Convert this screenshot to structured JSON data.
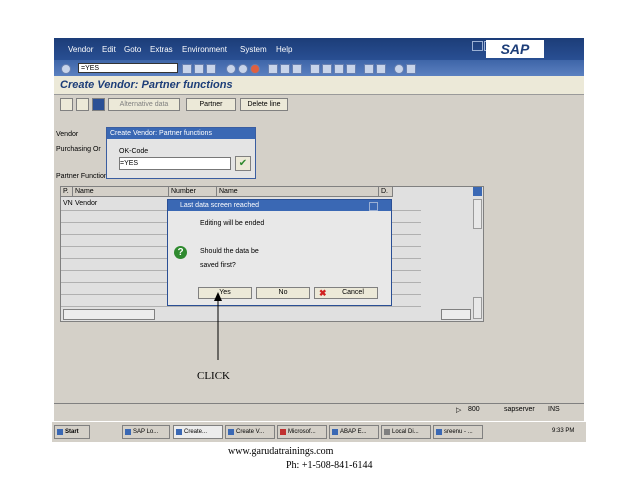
{
  "menubar": {
    "items": [
      "Vendor",
      "Edit",
      "Goto",
      "Extras",
      "Environment",
      "System",
      "Help"
    ],
    "logo": "SAP"
  },
  "toolbar": {
    "okcode_value": "=YES"
  },
  "screen": {
    "title": "Create Vendor: Partner functions"
  },
  "app_toolbar": {
    "alt_data_label": "Alternative data",
    "partner_label": "Partner",
    "delete_line_label": "Delete line"
  },
  "fields": {
    "vendor_label": "Vendor",
    "purchasing_label": "Purchasing Or",
    "partner_functions_label": "Partner Functions"
  },
  "okcode_popup": {
    "title": "Create Vendor: Partner functions",
    "label": "OK-Code",
    "value": "=YES"
  },
  "table": {
    "headers": [
      "P.",
      "Name",
      "Number",
      "Name",
      "D."
    ],
    "rows": [
      {
        "p": "VN",
        "name": "Vendor"
      }
    ]
  },
  "dialog": {
    "title": "Last data screen reached",
    "line1": "Editing will be ended",
    "line2": "Should the data be",
    "line3": "saved first?",
    "yes": "Yes",
    "no": "No",
    "cancel": "Cancel"
  },
  "annotation": {
    "click": "CLICK"
  },
  "status": {
    "client": "800",
    "server": "sapserver",
    "mode": "INS"
  },
  "taskbar": {
    "start": "Start",
    "items": [
      "SAP Lo...",
      "Create...",
      "Create V...",
      "Microsof...",
      "ABAP E...",
      "Local Di...",
      "sreenu - ..."
    ],
    "clock": "9:33 PM"
  },
  "footer": {
    "website": "www.garudatrainings.com",
    "phone": "Ph: +1-508-841-6144"
  },
  "colors": {
    "header_blue": "#1c3d78",
    "dialog_title": "#3a68b4"
  }
}
